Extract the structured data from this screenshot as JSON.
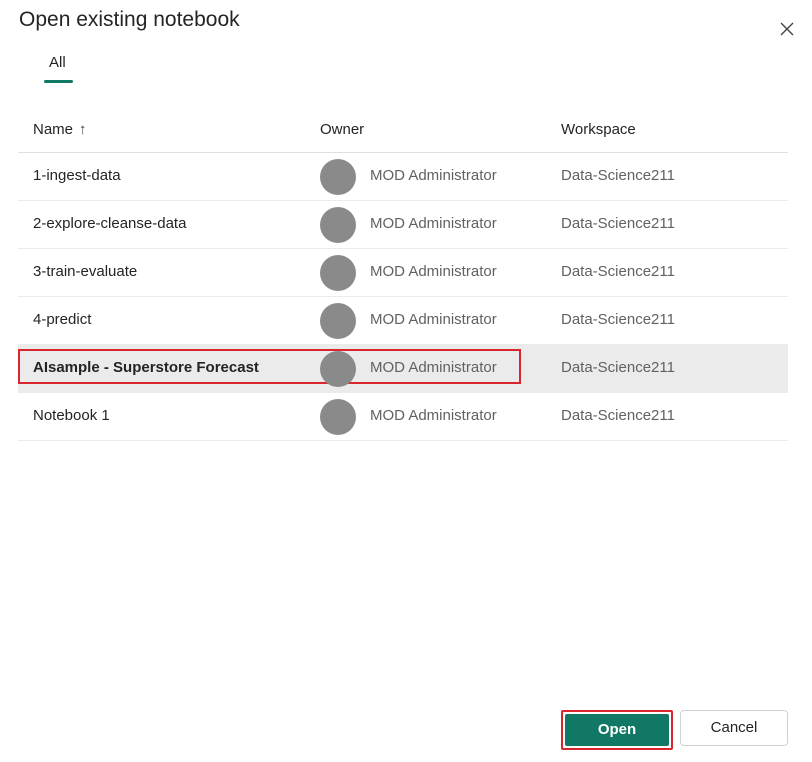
{
  "dialog": {
    "title": "Open existing notebook"
  },
  "tabs": [
    {
      "label": "All",
      "selected": true
    }
  ],
  "table": {
    "columns": {
      "name": "Name",
      "sort_indicator": "↑",
      "owner": "Owner",
      "workspace": "Workspace"
    },
    "rows": [
      {
        "name": "1-ingest-data",
        "owner": "MOD Administrator",
        "workspace": "Data-Science211"
      },
      {
        "name": "2-explore-cleanse-data",
        "owner": "MOD Administrator",
        "workspace": "Data-Science211"
      },
      {
        "name": "3-train-evaluate",
        "owner": "MOD Administrator",
        "workspace": "Data-Science211"
      },
      {
        "name": "4-predict",
        "owner": "MOD Administrator",
        "workspace": "Data-Science211"
      },
      {
        "name": "AIsample - Superstore Forecast",
        "owner": "MOD Administrator",
        "workspace": "Data-Science211"
      },
      {
        "name": "Notebook 1",
        "owner": "MOD Administrator",
        "workspace": "Data-Science211"
      }
    ],
    "selected_index": 4
  },
  "footer": {
    "open_label": "Open",
    "cancel_label": "Cancel"
  },
  "colors": {
    "accent": "#117865",
    "highlight": "#d9262c",
    "avatar": "#8a8a8a",
    "selected_row": "#ebebeb"
  },
  "icons": {
    "close": "close-icon",
    "sort": "arrow-up-icon",
    "avatar": "person-avatar"
  }
}
